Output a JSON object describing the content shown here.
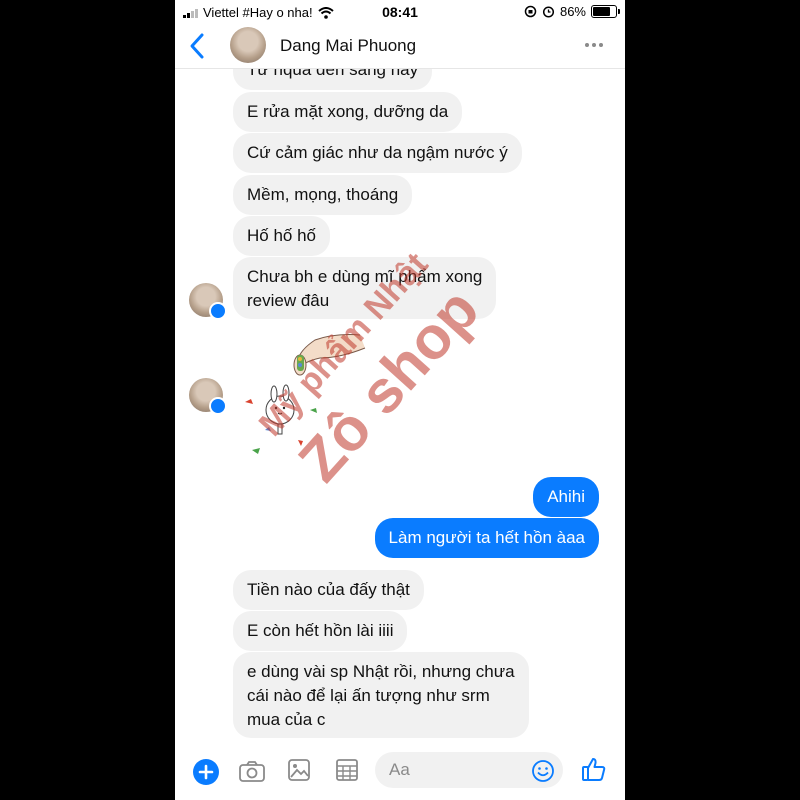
{
  "status": {
    "carrier": "Viettel #Hay o nha!",
    "time": "08:41",
    "battery": "86%",
    "battery_level": 0.86
  },
  "header": {
    "contact_name": "Dang Mai Phuong",
    "back_icon": "chevron-left-icon",
    "more_icon": "more-horizontal-icon"
  },
  "messages": {
    "m0": "Từ hqua đến sáng nay",
    "m1": "E rửa mặt xong, dưỡng da",
    "m2": "Cứ cảm giác như da ngậm nước ý",
    "m3": "Mềm, mọng, thoáng",
    "m4": "Hố hố hố",
    "m5_line1": "Chưa bh e dùng mĩ phẩm xong",
    "m5_line2": "review đâu",
    "o1": "Ahihi",
    "o2": "Làm người ta hết hồn àaa",
    "m6": "Tiền nào của đấy thật",
    "m7": "E còn hết hồn lài iiii",
    "m8_line1": "e dùng vài sp Nhật rồi, nhưng chưa",
    "m8_line2": "cái nào để lại ấn tượng như srm",
    "m8_line3": "mua của c"
  },
  "watermark": {
    "line1": "Mỹ phẩm Nhật",
    "line2": "Zô shop"
  },
  "composer": {
    "placeholder": "Aa",
    "icons": [
      "plus-icon",
      "camera-icon",
      "image-icon",
      "grid-icon",
      "emoji-icon",
      "thumbs-up-icon"
    ]
  },
  "colors": {
    "accent": "#0a7cff",
    "incoming_bubble": "#f1f1f1",
    "watermark": "#c0392b"
  }
}
